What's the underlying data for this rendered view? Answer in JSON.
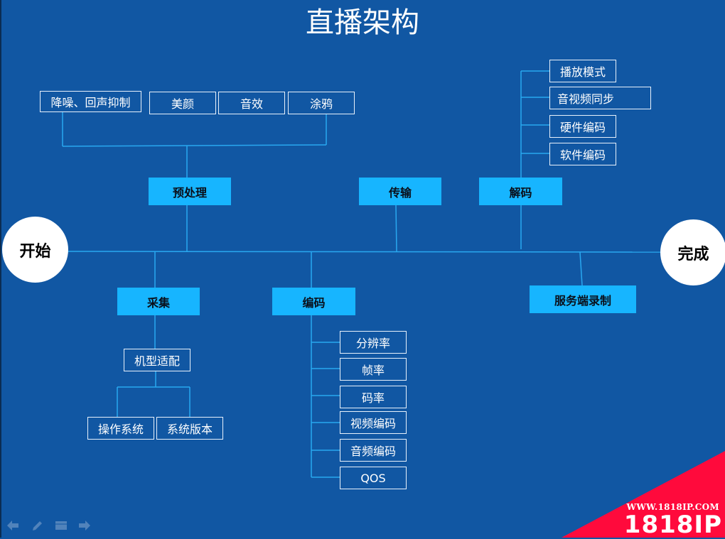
{
  "slide": {
    "title": "直播架构",
    "colors": {
      "background": "#1157a3",
      "stage_fill": "#17b5ff",
      "line": "#29a8f0",
      "badge": "#ff0a3c"
    }
  },
  "endpoints": {
    "start": "开始",
    "end": "完成"
  },
  "stages": {
    "preprocess": "预处理",
    "transport": "传输",
    "decode": "解码",
    "capture": "采集",
    "encode": "编码",
    "server_record": "服务端录制"
  },
  "preprocess_items": [
    "降噪、回声抑制",
    "美颜",
    "音效",
    "涂鸦"
  ],
  "decode_items": [
    "播放模式",
    "音视频同步",
    "硬件编码",
    "软件编码"
  ],
  "capture_tree": {
    "adapter": "机型适配",
    "children": [
      "操作系统",
      "系统版本"
    ]
  },
  "encode_items": [
    "分辨率",
    "帧率",
    "码率",
    "视频编码",
    "音频编码",
    "QOS"
  ],
  "nav": {
    "icons": [
      "arrow-left-icon",
      "pen-icon",
      "menu-icon",
      "arrow-right-icon"
    ]
  },
  "watermark": {
    "url": "WWW.1818IP.COM",
    "brand": "1818IP"
  }
}
